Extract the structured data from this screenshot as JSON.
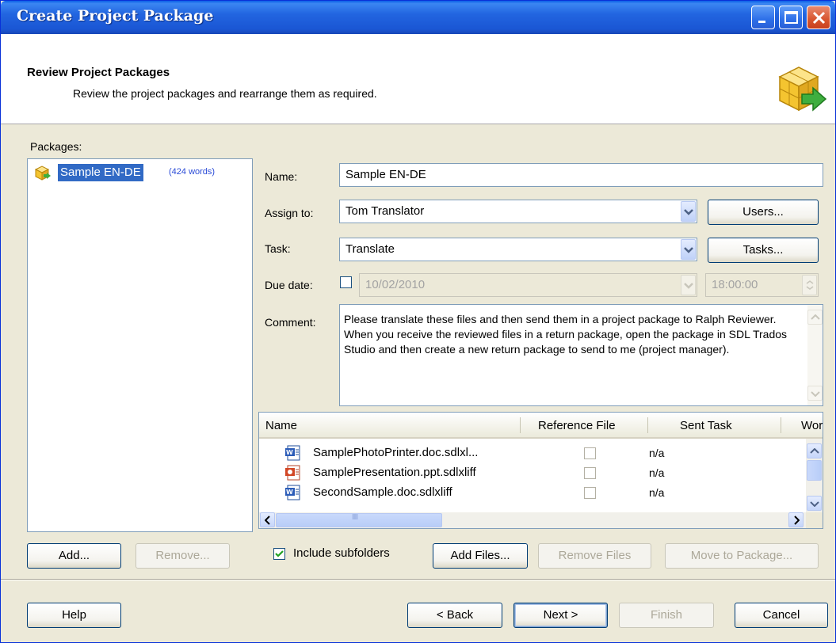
{
  "window": {
    "title": "Create Project Package"
  },
  "header": {
    "title": "Review Project Packages",
    "subtitle": "Review the project packages and  rearrange them as required."
  },
  "packages": {
    "label": "Packages:",
    "items": [
      {
        "name": "Sample EN-DE",
        "words": "(424 words)",
        "selected": true
      }
    ],
    "add_label": "Add...",
    "remove_label": "Remove..."
  },
  "form": {
    "name_label": "Name:",
    "name_value": "Sample EN-DE",
    "assign_label": "Assign to:",
    "assign_value": "Tom Translator",
    "users_button": "Users...",
    "task_label": "Task:",
    "task_value": "Translate",
    "tasks_button": "Tasks...",
    "due_label": "Due date:",
    "due_date": "10/02/2010",
    "due_time": "18:00:00",
    "comment_label": "Comment:",
    "comment_text": "Please translate these files and then send them in a project package to Ralph Reviewer. When you receive the reviewed files in a return package, open the package in SDL Trados Studio and then create a new return package to send to me (project manager)."
  },
  "files": {
    "columns": [
      "Name",
      "Reference File",
      "Sent Task",
      "Wor"
    ],
    "rows": [
      {
        "name": "SamplePhotoPrinter.doc.sdlxl...",
        "type": "word-doc-icon",
        "sent_task": "n/a"
      },
      {
        "name": "SamplePresentation.ppt.sdlxliff",
        "type": "powerpoint-icon",
        "sent_task": "n/a"
      },
      {
        "name": "SecondSample.doc.sdlxliff",
        "type": "word-doc-icon",
        "sent_task": "n/a"
      }
    ],
    "include_subfolders_label": "Include subfolders",
    "include_subfolders_checked": true,
    "add_files_label": "Add Files...",
    "remove_files_label": "Remove Files",
    "move_label": "Move to Package..."
  },
  "footer": {
    "help": "Help",
    "back": "< Back",
    "next": "Next >",
    "finish": "Finish",
    "cancel": "Cancel"
  },
  "colors": {
    "titlebar": "#2265E0",
    "dialog_bg": "#ECE9D8",
    "selection": "#316AC5",
    "word_count": "#2A4BD7"
  }
}
